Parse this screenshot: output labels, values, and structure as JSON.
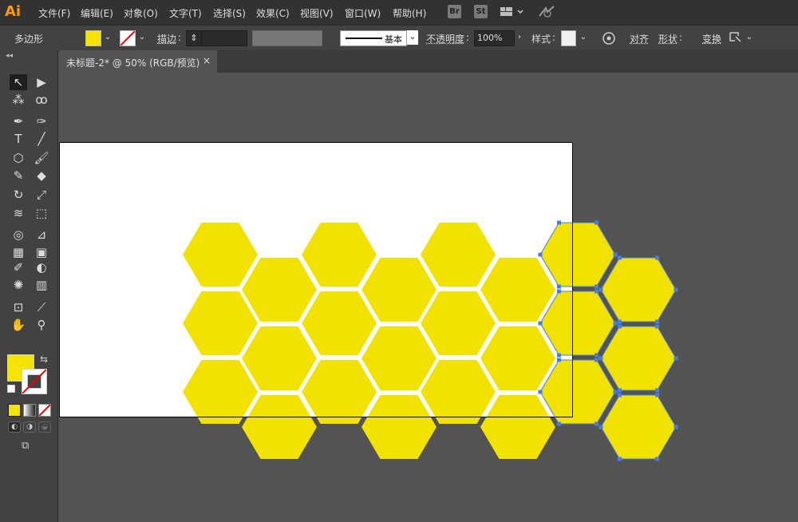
{
  "app": {
    "logo": "Ai"
  },
  "menu": [
    "文件(F)",
    "编辑(E)",
    "对象(O)",
    "文字(T)",
    "选择(S)",
    "效果(C)",
    "视图(V)",
    "窗口(W)",
    "帮助(H)"
  ],
  "menubar_buttons": {
    "bridge": "Br",
    "stock": "St"
  },
  "controlbar": {
    "object_type": "多边形",
    "stroke_label": "描边",
    "stroke_profile": "基本",
    "opacity_label": "不透明度",
    "opacity_value": "100%",
    "style_label": "样式",
    "align_label": "对齐",
    "shape_label": "形状",
    "transform_label": "变换"
  },
  "document_tab": {
    "title": "未标题-2* @ 50% (RGB/预览)",
    "close": "×"
  },
  "colors": {
    "fill": "#f5e400",
    "hex": "#f2e200",
    "selection": "#4a7fe0",
    "artboard": "#ffffff",
    "pasteboard": "#535353"
  },
  "tools": [
    {
      "name": "selection-tool-icon",
      "glyph": "↖"
    },
    {
      "name": "direct-selection-tool-icon",
      "glyph": "▶"
    },
    {
      "name": "magic-wand-tool-icon",
      "glyph": "⁂"
    },
    {
      "name": "lasso-tool-icon",
      "glyph": "ꝏ"
    },
    {
      "name": "pen-tool-icon",
      "glyph": "✒"
    },
    {
      "name": "curvature-tool-icon",
      "glyph": "✑"
    },
    {
      "name": "type-tool-icon",
      "glyph": "T"
    },
    {
      "name": "line-tool-icon",
      "glyph": "╱"
    },
    {
      "name": "polygon-tool-icon",
      "glyph": "⬡"
    },
    {
      "name": "paintbrush-tool-icon",
      "glyph": "🖌"
    },
    {
      "name": "blob-brush-tool-icon",
      "glyph": "✎"
    },
    {
      "name": "eraser-tool-icon",
      "glyph": "◆"
    },
    {
      "name": "rotate-tool-icon",
      "glyph": "↻"
    },
    {
      "name": "scale-tool-icon",
      "glyph": "⤢"
    },
    {
      "name": "width-tool-icon",
      "glyph": "≋"
    },
    {
      "name": "free-transform-tool-icon",
      "glyph": "⬚"
    },
    {
      "name": "shape-builder-tool-icon",
      "glyph": "◎"
    },
    {
      "name": "perspective-grid-tool-icon",
      "glyph": "⊿"
    },
    {
      "name": "mesh-tool-icon",
      "glyph": "▦"
    },
    {
      "name": "gradient-tool-icon",
      "glyph": "▣"
    },
    {
      "name": "eyedropper-tool-icon",
      "glyph": "✐"
    },
    {
      "name": "blend-tool-icon",
      "glyph": "◐"
    },
    {
      "name": "symbol-sprayer-tool-icon",
      "glyph": "✺"
    },
    {
      "name": "column-graph-tool-icon",
      "glyph": "▥"
    },
    {
      "name": "artboard-tool-icon",
      "glyph": "⊡"
    },
    {
      "name": "slice-tool-icon",
      "glyph": "⟋"
    },
    {
      "name": "hand-tool-icon",
      "glyph": "✋"
    },
    {
      "name": "zoom-tool-icon",
      "glyph": "⚲"
    }
  ]
}
